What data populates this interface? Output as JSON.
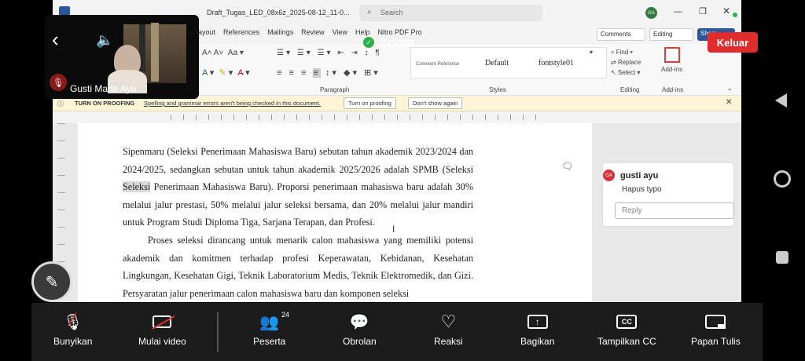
{
  "title_bar": {
    "doc_title": "Draft_Tugas_LED_08x6z_2025-08-12_11-0...",
    "search_placeholder": "Search",
    "avatar": "GA"
  },
  "ribbon_tabs": [
    "Layout",
    "References",
    "Mailings",
    "Review",
    "View",
    "Help",
    "Nitro PDF Pro"
  ],
  "ribbon_right": {
    "comments": "Comments",
    "editing": "Editing",
    "share": "Share"
  },
  "ribbon": {
    "styles": [
      "Comment Reference",
      "Default",
      "fontstyle01"
    ],
    "groups": {
      "paragraph": "Paragraph",
      "styles": "Styles",
      "editing": "Editing",
      "addins": "Add-ins"
    },
    "editing_items": [
      "Find",
      "Replace",
      "Select"
    ],
    "addins_label": "Add-ins"
  },
  "proofing": {
    "title": "TURN ON PROOFING",
    "message": "Spelling and grammar errors aren't being checked in this document.",
    "turn_on": "Turn on proofing",
    "dont_show": "Don't show again"
  },
  "document": {
    "p1_a": "Sipenmaru (Seleksi Penerimaan Mahasiswa Baru) sebutan tahun akademik 2023/2024 dan 2024/2025, sedangkan sebutan untuk tahun akademik 2025/2026 adalah SPMB (Seleksi ",
    "p1_hl": "Seleksi",
    "p1_b": " Penerimaan Mahasiswa Baru). Proporsi penerimaan mahasiswa baru adalah 30% melalui jalur prestasi, 50% melalui jalur seleksi bersama, dan 20% melalui jalur mandiri untuk Program Studi Diploma Tiga, Sarjana Terapan, dan Profesi.",
    "p2": "Proses seleksi dirancang untuk menarik calon mahasiswa yang memiliki potensi akademik dan komitmen terhadap profesi Keperawatan, Kebidanan, Kesehatan Lingkungan, Kesehatan Gigi, Teknik Laboratorium Medis, Teknik Elektromedik, dan Gizi. Persyaratan jalur penerimaan calon mahasiswa baru dan komponen seleksi"
  },
  "comment": {
    "avatar": "GA",
    "author": "gusti ayu",
    "text": "Hapus typo",
    "reply_placeholder": "Reply"
  },
  "zoom": {
    "app_title": "Zoom",
    "leave": "Keluar",
    "self_name": "Gusti Made Ayu",
    "toolbar": [
      {
        "label": "Bunyikan",
        "icon": "mic-muted-icon"
      },
      {
        "label": "Mulai video",
        "icon": "video-off-icon"
      },
      {
        "label": "Peserta",
        "icon": "participants-icon",
        "count": "24"
      },
      {
        "label": "Obrolan",
        "icon": "chat-icon"
      },
      {
        "label": "Reaksi",
        "icon": "heart-icon"
      },
      {
        "label": "Bagikan",
        "icon": "share-icon"
      },
      {
        "label": "Tampilkan CC",
        "icon": "cc-icon"
      },
      {
        "label": "Papan Tulis",
        "icon": "whiteboard-icon"
      }
    ],
    "colors": {
      "leave": "#e02c2c",
      "toolbar_bg": "#1c1c1c",
      "shield": "#2bb24c"
    }
  }
}
